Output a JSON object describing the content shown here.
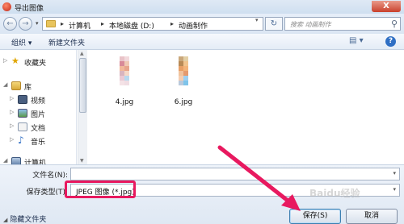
{
  "window": {
    "title": "导出图像",
    "close_glyph": "X"
  },
  "nav": {
    "back_glyph": "←",
    "forward_glyph": "→",
    "breadcrumb": [
      "计算机",
      "本地磁盘 (D:)",
      "动画制作"
    ],
    "search_placeholder": "搜索 动画制作",
    "refresh_glyph": "↻"
  },
  "toolbar": {
    "organize": "组织 ▾",
    "new_folder": "新建文件夹",
    "view_glyph": "▤ ▾",
    "help_glyph": "?"
  },
  "sidebar": {
    "items": [
      {
        "label": "收藏夹",
        "icon": "star-icon"
      },
      {
        "label": "库",
        "icon": "library-icon"
      },
      {
        "label": "视频",
        "icon": "video-icon"
      },
      {
        "label": "图片",
        "icon": "pictures-icon"
      },
      {
        "label": "文档",
        "icon": "documents-icon"
      },
      {
        "label": "音乐",
        "icon": "music-icon"
      },
      {
        "label": "计算机",
        "icon": "computer-icon"
      }
    ]
  },
  "files": [
    {
      "name": "4.jpg"
    },
    {
      "name": "6.jpg"
    }
  ],
  "bottom": {
    "filename_label": "文件名(N):",
    "filename_value": "",
    "type_label": "保存类型(T):",
    "type_value": "JPEG 图像 (*.jpg)",
    "hide_folders": "隐藏文件夹",
    "save_button": "保存(S)",
    "cancel_button": "取消"
  },
  "watermark": "Baidu经验",
  "colors": {
    "highlight": "#e8195f",
    "accent": "#2f6fc4"
  }
}
